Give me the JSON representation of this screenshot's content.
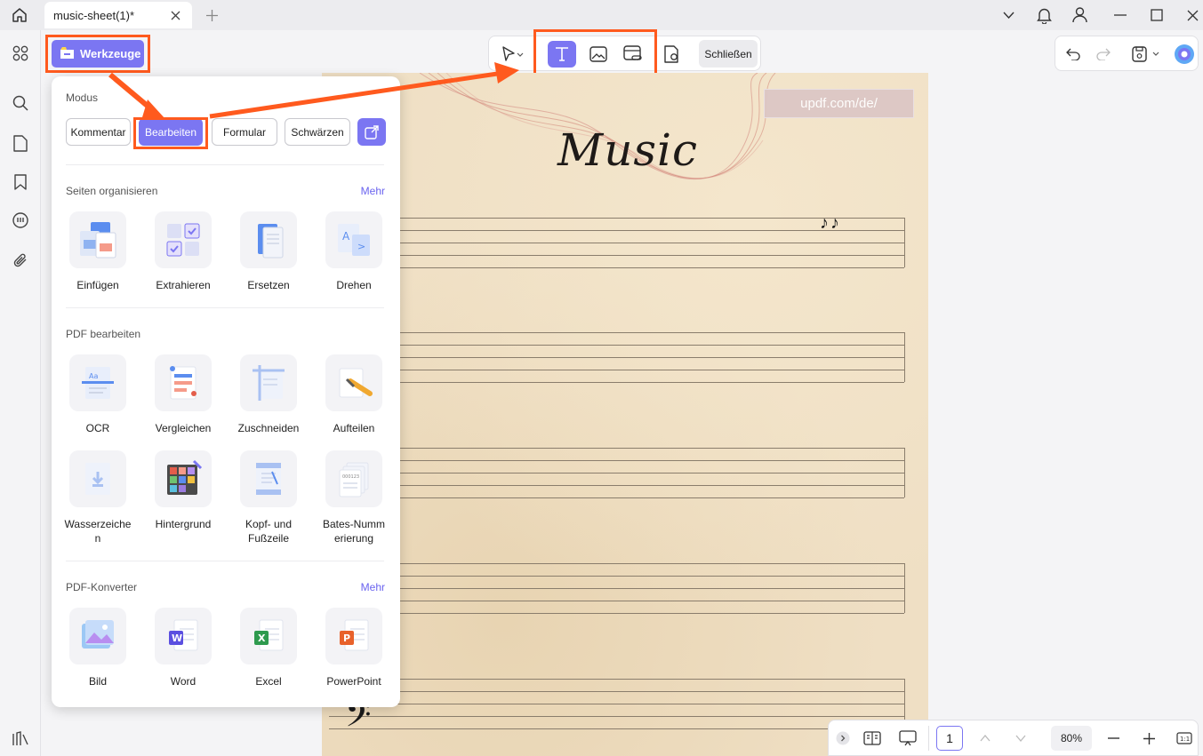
{
  "titlebar": {
    "tab_title": "music-sheet(1)*"
  },
  "toolbar": {
    "werkzeuge_label": "Werkzeuge",
    "close_label": "Schließen"
  },
  "panel": {
    "mode_title": "Modus",
    "modes": [
      "Kommentar",
      "Bearbeiten",
      "Formular",
      "Schwärzen"
    ],
    "selected_mode": "Bearbeiten",
    "organize": {
      "title": "Seiten organisieren",
      "more": "Mehr",
      "tools": [
        "Einfügen",
        "Extrahieren",
        "Ersetzen",
        "Drehen"
      ]
    },
    "edit": {
      "title": "PDF bearbeiten",
      "tools_row1": [
        "OCR",
        "Vergleichen",
        "Zuschneiden",
        "Aufteilen"
      ],
      "tools_row2": [
        "Wasserzeiche\nn",
        "Hintergrund",
        "Kopf- und\nFußzeile",
        "Bates-Numm\nerierung"
      ]
    },
    "convert": {
      "title": "PDF-Konverter",
      "more": "Mehr",
      "tools": [
        "Bild",
        "Word",
        "Excel",
        "PowerPoint"
      ]
    }
  },
  "document": {
    "watermark_url": "updf.com/de/",
    "title": "Music",
    "notes": "♪♪"
  },
  "bottombar": {
    "page_number": "1",
    "zoom": "80%"
  },
  "colors": {
    "accent": "#7b76f2",
    "highlight": "#ff5a1e",
    "paper": "#efdfc4"
  },
  "icons": [
    "home-icon",
    "close-icon",
    "plus-icon",
    "chevron-down-icon",
    "bell-icon",
    "user-icon",
    "minimize-icon",
    "maximize-icon",
    "grid-icon",
    "search-icon",
    "pages-icon",
    "bookmark-icon",
    "comment-icon",
    "attachment-icon",
    "layers-icon",
    "cursor-icon",
    "text-tool-icon",
    "image-tool-icon",
    "link-tool-icon",
    "stamp-icon",
    "undo-icon",
    "redo-icon",
    "save-icon",
    "ai-assistant-icon",
    "external-link-icon",
    "reading-mode-icon",
    "presentation-icon",
    "zoom-out-icon",
    "zoom-in-icon",
    "fit-page-icon"
  ]
}
